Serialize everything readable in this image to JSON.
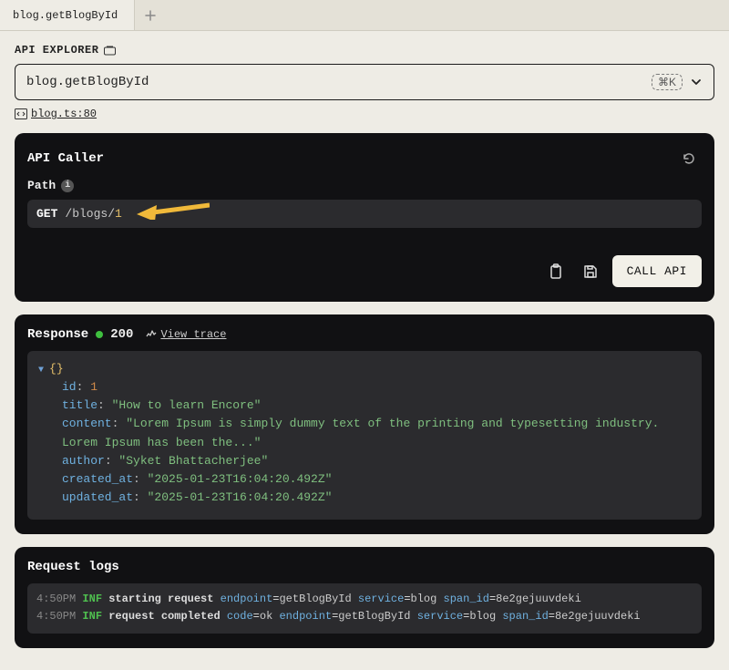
{
  "tabbar": {
    "active_tab": "blog.getBlogById"
  },
  "explorer": {
    "label": "API EXPLORER",
    "value": "blog.getBlogById",
    "shortcut": "⌘K",
    "file_label": "blog.ts:80"
  },
  "caller": {
    "title": "API Caller",
    "path_label": "Path",
    "method": "GET",
    "path": "/blogs/",
    "path_id": "1",
    "call_button": "CALL API"
  },
  "response": {
    "title": "Response",
    "status": "200",
    "trace_label": "View trace",
    "json": {
      "id": 1,
      "title": "How to learn Encore",
      "content": "Lorem Ipsum is simply dummy text of the printing and typesetting industry. Lorem Ipsum has been the...",
      "author": "Syket Bhattacherjee",
      "created_at": "2025-01-23T16:04:20.492Z",
      "updated_at": "2025-01-23T16:04:20.492Z"
    }
  },
  "logs": {
    "title": "Request logs",
    "entries": [
      {
        "time": "4:50PM",
        "level": "INF",
        "msg": "starting request",
        "kv": [
          [
            "endpoint",
            "getBlogById"
          ],
          [
            "service",
            "blog"
          ],
          [
            "span_id",
            "8e2gejuuvdeki"
          ]
        ]
      },
      {
        "time": "4:50PM",
        "level": "INF",
        "msg": "request completed",
        "kv": [
          [
            "code",
            "ok"
          ],
          [
            "endpoint",
            "getBlogById"
          ],
          [
            "service",
            "blog"
          ],
          [
            "span_id",
            "8e2gejuuvdeki"
          ]
        ]
      }
    ]
  }
}
